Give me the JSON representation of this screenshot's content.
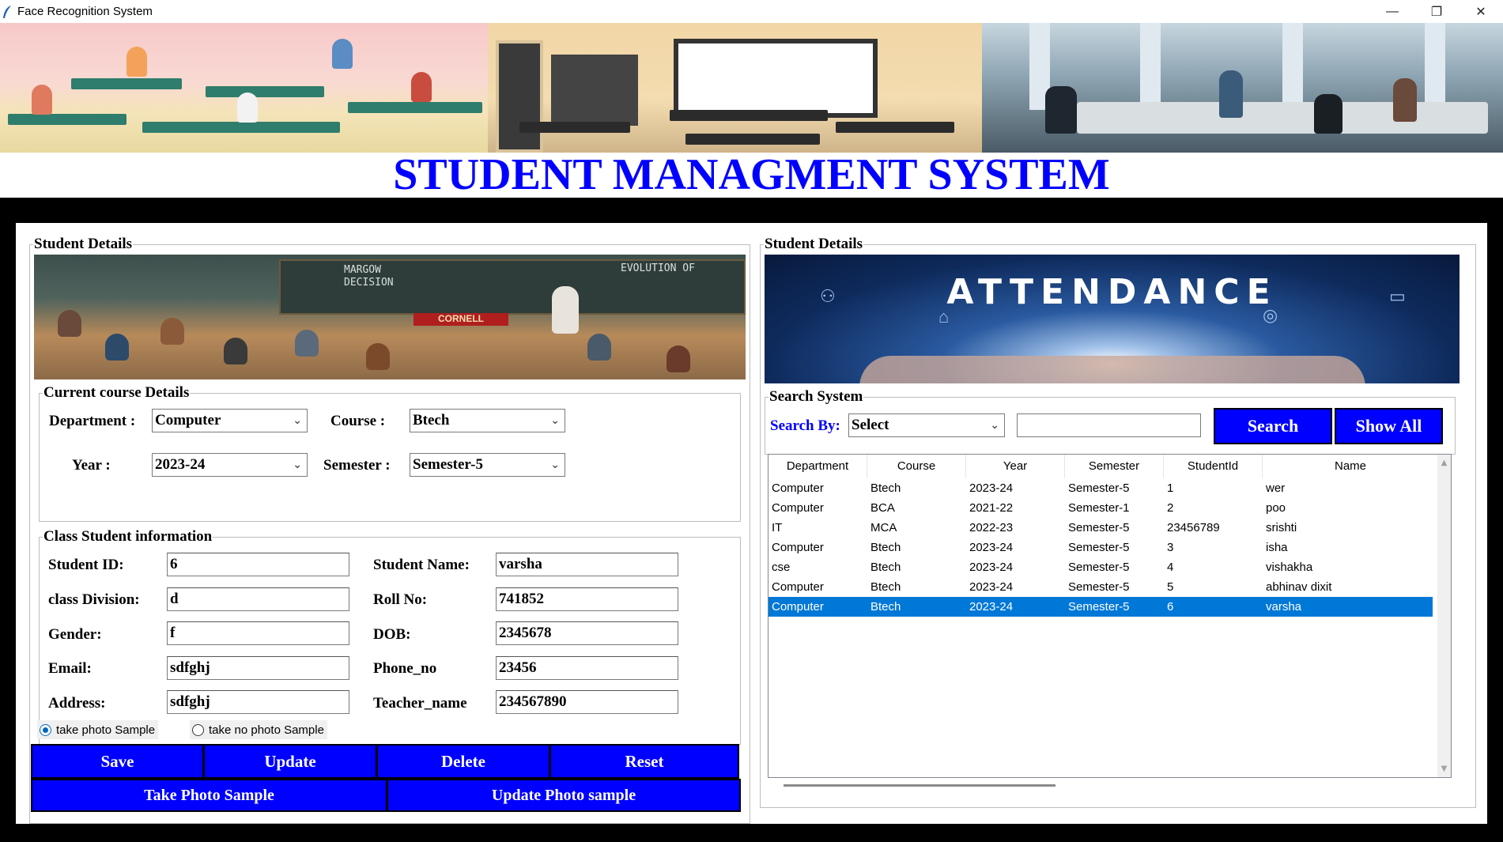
{
  "window": {
    "title": "Face Recognition System",
    "controls": {
      "minimize": "—",
      "restore": "❐",
      "close": "✕"
    }
  },
  "header": {
    "title": "STUDENT MANAGMENT SYSTEM"
  },
  "left_panel": {
    "legend": "Student Details",
    "image_text": {
      "board_line1": "MARGOW",
      "board_line2": "DECISION",
      "board_right": "EVOLUTION OF",
      "sign": "CORNELL"
    },
    "course": {
      "legend": "Current course Details",
      "department_label": "Department :",
      "department_value": "Computer",
      "course_label": "Course :",
      "course_value": "Btech",
      "year_label": "Year :",
      "year_value": "2023-24",
      "semester_label": "Semester :",
      "semester_value": "Semester-5"
    },
    "student": {
      "legend": "Class Student information",
      "student_id_label": "Student ID:",
      "student_id": "6",
      "student_name_label": "Student Name:",
      "student_name": "varsha",
      "division_label": "class Division:",
      "division": "d",
      "roll_label": "Roll No:",
      "roll": "741852",
      "gender_label": "Gender:",
      "gender": "f",
      "dob_label": "DOB:",
      "dob": "2345678",
      "email_label": "Email:",
      "email": "sdfghj",
      "phone_label": "Phone_no",
      "phone": "23456",
      "address_label": "Address:",
      "address": "sdfghj",
      "teacher_label": "Teacher_name",
      "teacher": "234567890",
      "radio_photo": "take photo Sample",
      "radio_no_photo": "take no photo Sample",
      "selected_radio": "take photo Sample"
    },
    "buttons": {
      "save": "Save",
      "update": "Update",
      "delete": "Delete",
      "reset": "Reset",
      "take_photo": "Take Photo Sample",
      "update_photo": "Update Photo sample"
    }
  },
  "right_panel": {
    "legend": "Student Details",
    "image_text": "ATTENDANCE",
    "search": {
      "legend": "Search System",
      "label": "Search By:",
      "select_value": "Select",
      "input_value": "",
      "search_button": "Search",
      "show_all_button": "Show All"
    },
    "table": {
      "columns": [
        "Department",
        "Course",
        "Year",
        "Semester",
        "StudentId",
        "Name"
      ],
      "rows": [
        [
          "Computer",
          "Btech",
          "2023-24",
          "Semester-5",
          "1",
          "wer"
        ],
        [
          "Computer",
          "BCA",
          "2021-22",
          "Semester-1",
          "2",
          "poo"
        ],
        [
          "IT",
          "MCA",
          "2022-23",
          "Semester-5",
          "23456789",
          "srishti"
        ],
        [
          "Computer",
          "Btech",
          "2023-24",
          "Semester-5",
          "3",
          "isha"
        ],
        [
          "cse",
          "Btech",
          "2023-24",
          "Semester-5",
          "4",
          "vishakha"
        ],
        [
          "Computer",
          "Btech",
          "2023-24",
          "Semester-5",
          "5",
          "abhinav dixit"
        ],
        [
          "Computer",
          "Btech",
          "2023-24",
          "Semester-5",
          "6",
          "varsha"
        ]
      ],
      "selected_row": 6
    }
  },
  "colors": {
    "accent": "#0000ff",
    "selection": "#0078d7",
    "background": "#000000"
  }
}
